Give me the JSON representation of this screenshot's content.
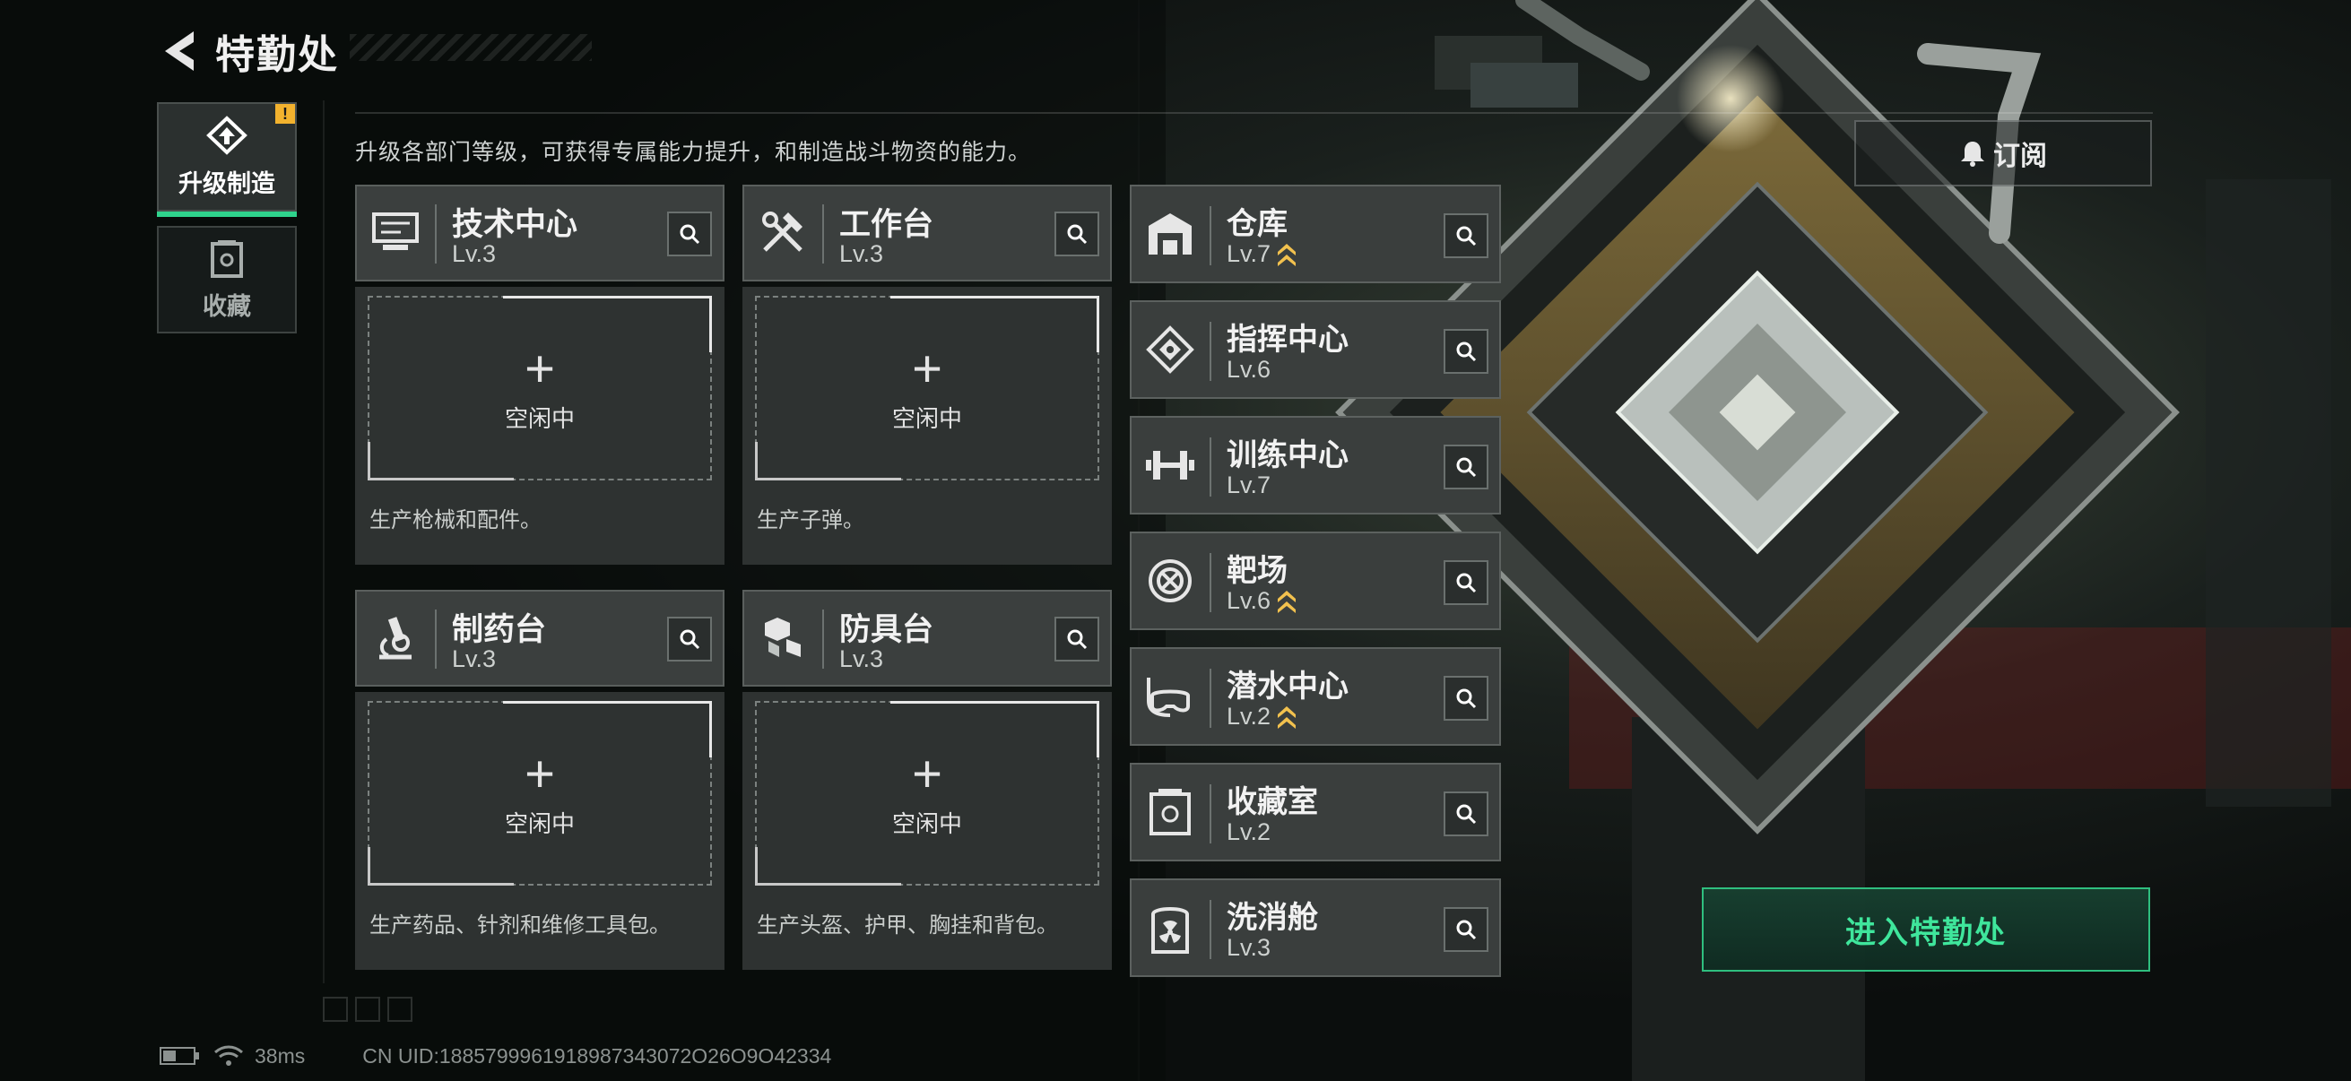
{
  "header": {
    "title": "特勤处",
    "back_icon": "back-arrow-icon"
  },
  "sidebar": {
    "tabs": [
      {
        "label": "升级制造",
        "icon": "upgrade-icon",
        "active": true,
        "badge": "!"
      },
      {
        "label": "收藏",
        "icon": "collection-icon",
        "active": false
      }
    ]
  },
  "description": "升级各部门等级，可获得专属能力提升，和制造战斗物资的能力。",
  "subscribe": {
    "label": "订阅",
    "icon": "bell-icon"
  },
  "workstations": [
    {
      "name": "技术中心",
      "level": "Lv.3",
      "slot_plus": "+",
      "slot_label": "空闲中",
      "desc": "生产枪械和配件。",
      "icon": "tech-center-icon"
    },
    {
      "name": "工作台",
      "level": "Lv.3",
      "slot_plus": "+",
      "slot_label": "空闲中",
      "desc": "生产子弹。",
      "icon": "workbench-icon"
    },
    {
      "name": "制药台",
      "level": "Lv.3",
      "slot_plus": "+",
      "slot_label": "空闲中",
      "desc": "生产药品、针剂和维修工具包。",
      "icon": "pharmacy-icon"
    },
    {
      "name": "防具台",
      "level": "Lv.3",
      "slot_plus": "+",
      "slot_label": "空闲中",
      "desc": "生产头盔、护甲、胸挂和背包。",
      "icon": "armor-bench-icon"
    }
  ],
  "facilities": [
    {
      "name": "仓库",
      "level": "Lv.7",
      "upgradable": true,
      "icon": "warehouse-icon"
    },
    {
      "name": "指挥中心",
      "level": "Lv.6",
      "upgradable": false,
      "icon": "command-center-icon"
    },
    {
      "name": "训练中心",
      "level": "Lv.7",
      "upgradable": false,
      "icon": "dumbbell-icon"
    },
    {
      "name": "靶场",
      "level": "Lv.6",
      "upgradable": true,
      "icon": "target-icon"
    },
    {
      "name": "潜水中心",
      "level": "Lv.2",
      "upgradable": true,
      "icon": "diving-mask-icon"
    },
    {
      "name": "收藏室",
      "level": "Lv.2",
      "upgradable": false,
      "icon": "collection-room-icon"
    },
    {
      "name": "洗消舱",
      "level": "Lv.3",
      "upgradable": false,
      "icon": "radiation-icon"
    }
  ],
  "enter_button": {
    "label": "进入特勤处"
  },
  "status_bar": {
    "ping": "38ms",
    "uid": "CN UID:1885799961918987343072O26O9O42334"
  },
  "colors": {
    "accent": "#2fd38c",
    "enter_text": "#3fe69c",
    "badge": "#f2b22e",
    "upgrade_arrow": "#f2c14e"
  }
}
